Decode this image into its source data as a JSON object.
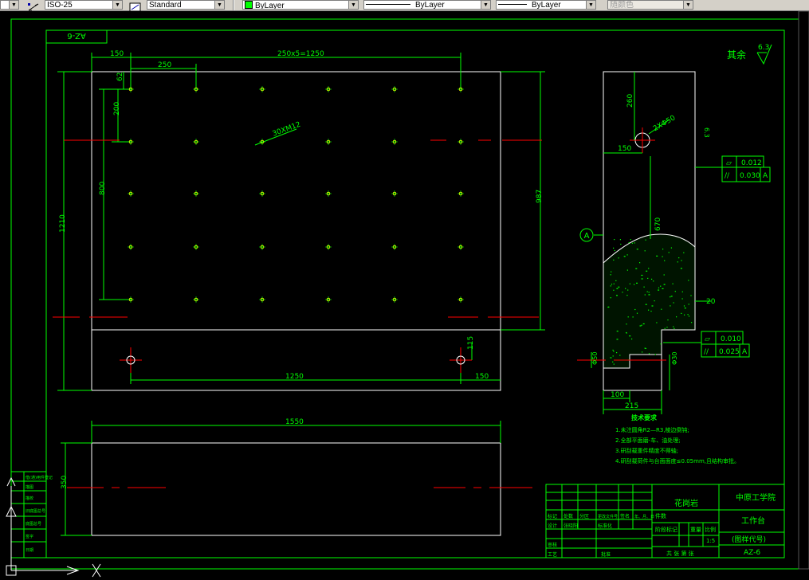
{
  "toolbar": {
    "dimstyle": "ISO-25",
    "textstyle": "Standard",
    "layer": "ByLayer",
    "linetype": "ByLayer",
    "lineweight": "ByLayer",
    "plotstyle": "随颜色"
  },
  "colors": {
    "background": "#000000",
    "border": "#00ff00",
    "geometry": "#ffffff",
    "centerline": "#ff0000",
    "holes": "#ffff00"
  },
  "drawing": {
    "id_top": "AZ-6",
    "roughness_prefix": "其余",
    "roughness_value": "6.3",
    "dims": {
      "d150a": "150",
      "d250": "250",
      "d250x5": "250x5=1250",
      "d62": "62",
      "d200": "200",
      "d800": "800",
      "d1210": "1210",
      "d987": "987",
      "d115": "115",
      "d1250": "1250",
      "d150b": "150",
      "d1550": "1550",
      "d350": "350",
      "holes_note": "30XM12",
      "side_260": "260",
      "side_2xd50": "2XΦ50",
      "side_150": "150",
      "side_670": "670",
      "side_20": "20",
      "side_50": "Φ50",
      "side_30": "Φ30",
      "side_100": "100",
      "side_215": "215",
      "side_rough": "6.3",
      "datum": "A"
    },
    "tol1": {
      "sym": "▱",
      "val": "0.012"
    },
    "tol2": {
      "sym": "//",
      "val": "0.030",
      "ref": "A"
    },
    "tol3": {
      "sym": "▱",
      "val": "0.010"
    },
    "tol4": {
      "sym": "//",
      "val": "0.025",
      "ref": "A"
    },
    "tech_title": "技术要求",
    "tech": [
      "1.未注圆角R2—R3,棱边倒钝;",
      "2.全部平面磨-车、油处理;",
      "3.研刮载重件精度不得轴;",
      "4.研刮载荷件与台面面度≤0.05mm,且结构审批。"
    ],
    "title_block": {
      "material": "花岗岩",
      "school": "中原工学院",
      "part_name": "工作台",
      "drawing_code": "(图样代号)",
      "drawing_no": "AZ-6",
      "scale": "1:5",
      "h": [
        "标记",
        "处数",
        "分区",
        "更改文件号",
        "签名",
        "年、月、日"
      ],
      "r1": [
        "设计",
        "张晓阳",
        "",
        "标准化"
      ],
      "r2": [
        "审核",
        ""
      ],
      "r3": [
        "工艺",
        "",
        "",
        "批准"
      ],
      "stage": "阶段标记",
      "weight": "重量",
      "ratio": "比例",
      "sheets": "共  张  第  张",
      "mark": "件数"
    },
    "left_strip": [
      "借(通)用件登记",
      "描图",
      "描校",
      "旧底图总号",
      "底图总号",
      "签字",
      "日期"
    ]
  }
}
